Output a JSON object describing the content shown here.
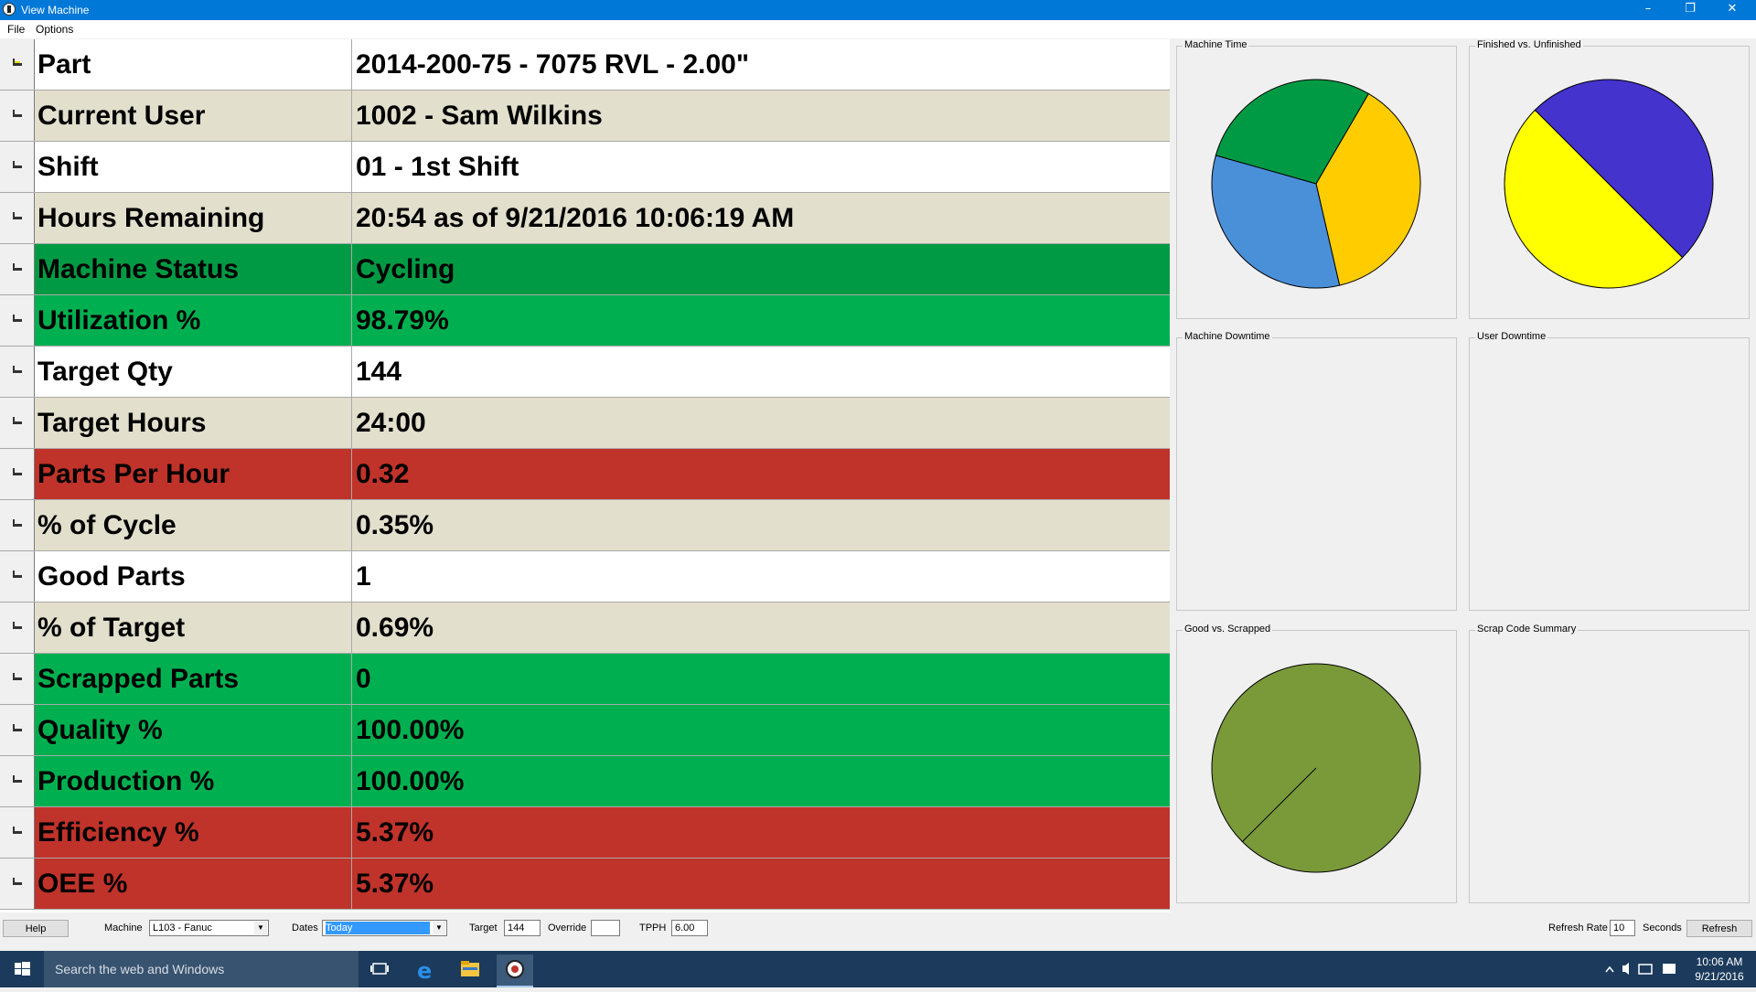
{
  "window": {
    "title": "View Machine",
    "controls": [
      "minimize-icon",
      "restore-icon",
      "close-icon"
    ]
  },
  "menu": {
    "items": [
      "File",
      "Options"
    ]
  },
  "grid": {
    "rows": [
      {
        "label": "Part",
        "value": "2014-200-75 - 7075 RVL - 2.00\"",
        "bg": "#ffffff"
      },
      {
        "label": "Current User",
        "value": "1002 - Sam Wilkins",
        "bg": "#e2dfcc"
      },
      {
        "label": "Shift",
        "value": "01 - 1st Shift",
        "bg": "#ffffff"
      },
      {
        "label": "Hours Remaining",
        "value": "20:54 as of 9/21/2016 10:06:19 AM",
        "bg": "#e2dfcc"
      },
      {
        "label": "Machine Status",
        "value": "Cycling",
        "bg": "#009a44"
      },
      {
        "label": "Utilization %",
        "value": "98.79%",
        "bg": "#00b050"
      },
      {
        "label": "Target Qty",
        "value": "144",
        "bg": "#ffffff"
      },
      {
        "label": "Target Hours",
        "value": "24:00",
        "bg": "#e2dfcc"
      },
      {
        "label": "Parts Per Hour",
        "value": "0.32",
        "bg": "#c0332a"
      },
      {
        "label": "% of Cycle",
        "value": "0.35%",
        "bg": "#e2dfcc"
      },
      {
        "label": "Good Parts",
        "value": "1",
        "bg": "#ffffff"
      },
      {
        "label": "% of Target",
        "value": "0.69%",
        "bg": "#e2dfcc"
      },
      {
        "label": "Scrapped Parts",
        "value": "0",
        "bg": "#00b050"
      },
      {
        "label": "Quality %",
        "value": "100.00%",
        "bg": "#00b050"
      },
      {
        "label": "Production %",
        "value": "100.00%",
        "bg": "#00b050"
      },
      {
        "label": "Efficiency %",
        "value": "5.37%",
        "bg": "#c0332a"
      },
      {
        "label": "OEE %",
        "value": "5.37%",
        "bg": "#c0332a"
      }
    ]
  },
  "panels": {
    "machine_time": {
      "title": "Machine Time"
    },
    "finished_unfinished": {
      "title": "Finished vs. Unfinished"
    },
    "machine_downtime": {
      "title": "Machine Downtime"
    },
    "user_downtime": {
      "title": "User Downtime"
    },
    "good_scrapped": {
      "title": "Good vs. Scrapped"
    },
    "scrap_code": {
      "title": "Scrap Code Summary"
    }
  },
  "chart_data": [
    {
      "type": "pie",
      "title": "Machine Time",
      "values": [
        38,
        29,
        33
      ],
      "colors": [
        "#ffcc00",
        "#009a44",
        "#4a90d9"
      ],
      "start_angle_deg": 283
    },
    {
      "type": "pie",
      "title": "Finished vs. Unfinished",
      "values": [
        50,
        50
      ],
      "colors": [
        "#ffff00",
        "#4433cc"
      ],
      "start_angle_deg": 135
    },
    {
      "type": "pie",
      "title": "Good vs. Scrapped",
      "values": [
        100
      ],
      "colors": [
        "#7a9a3a"
      ],
      "start_angle_deg": 315
    }
  ],
  "toolbar": {
    "help_label": "Help",
    "machine_label": "Machine",
    "machine_value": "L103 - Fanuc",
    "dates_label": "Dates",
    "dates_value": "Today",
    "target_label": "Target",
    "target_value": "144",
    "override_label": "Override",
    "override_value": "",
    "tpph_label": "TPPH",
    "tpph_value": "6.00",
    "refresh_rate_label": "Refresh Rate",
    "refresh_rate_value": "10",
    "seconds_label": "Seconds",
    "refresh_label": "Refresh"
  },
  "taskbar": {
    "search_placeholder": "Search the web and Windows",
    "time": "10:06 AM",
    "date": "9/21/2016"
  }
}
